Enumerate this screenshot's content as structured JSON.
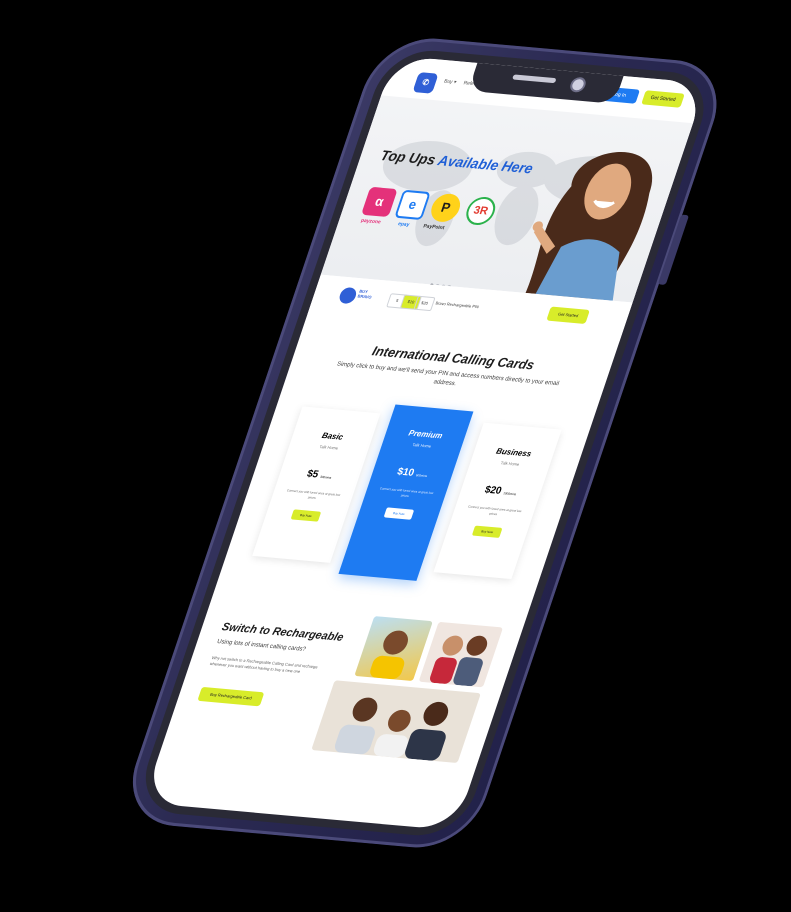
{
  "nav": {
    "links": [
      "Buy ▾",
      "Refer"
    ],
    "login_label": "Log In",
    "started_label": "Get Started"
  },
  "hero": {
    "title_plain": "Top Ups",
    "title_accent": "Available Here",
    "brands": [
      {
        "name": "payzone",
        "glyph": "α",
        "color": "#e4317a"
      },
      {
        "name": "epay",
        "glyph": "e",
        "color": "#1e7bf2"
      },
      {
        "name": "PayPoint",
        "glyph": "P",
        "color": "#ffd21a"
      },
      {
        "name": "",
        "glyph": "3R",
        "color": "#2bb24c"
      }
    ]
  },
  "strip": {
    "logo_text": [
      "BUY",
      "BRAVO"
    ],
    "chips": [
      "5",
      "$10",
      "$20"
    ],
    "text": "Bravo Rechargeable PIN",
    "button": "Get Started"
  },
  "calling_cards": {
    "title": "International Calling Cards",
    "subtitle": "Simply click to buy and we'll send your PIN and access numbers directly to your email address.",
    "plans": [
      {
        "name": "Basic",
        "sub": "Talk Home",
        "price": "$5",
        "unit": "300mins",
        "desc": "Connect you with loved ones at great low prices",
        "button": "Buy Now"
      },
      {
        "name": "Premium",
        "sub": "Talk Home",
        "price": "$10",
        "unit": "600mins",
        "desc": "Connect you with loved ones at great low prices",
        "button": "Buy Now"
      },
      {
        "name": "Business",
        "sub": "Talk Home",
        "price": "$20",
        "unit": "1000mins",
        "desc": "Connect you with loved ones at great low prices",
        "button": "Buy Now"
      }
    ]
  },
  "rechargeable": {
    "title": "Switch to Rechargeable",
    "subtitle": "Using lots of instant calling cards?",
    "body": "Why not switch to a Rechargeable Calling Card and recharge whenever you want without having to buy a new one",
    "button": "Buy Rechargeable Card"
  }
}
